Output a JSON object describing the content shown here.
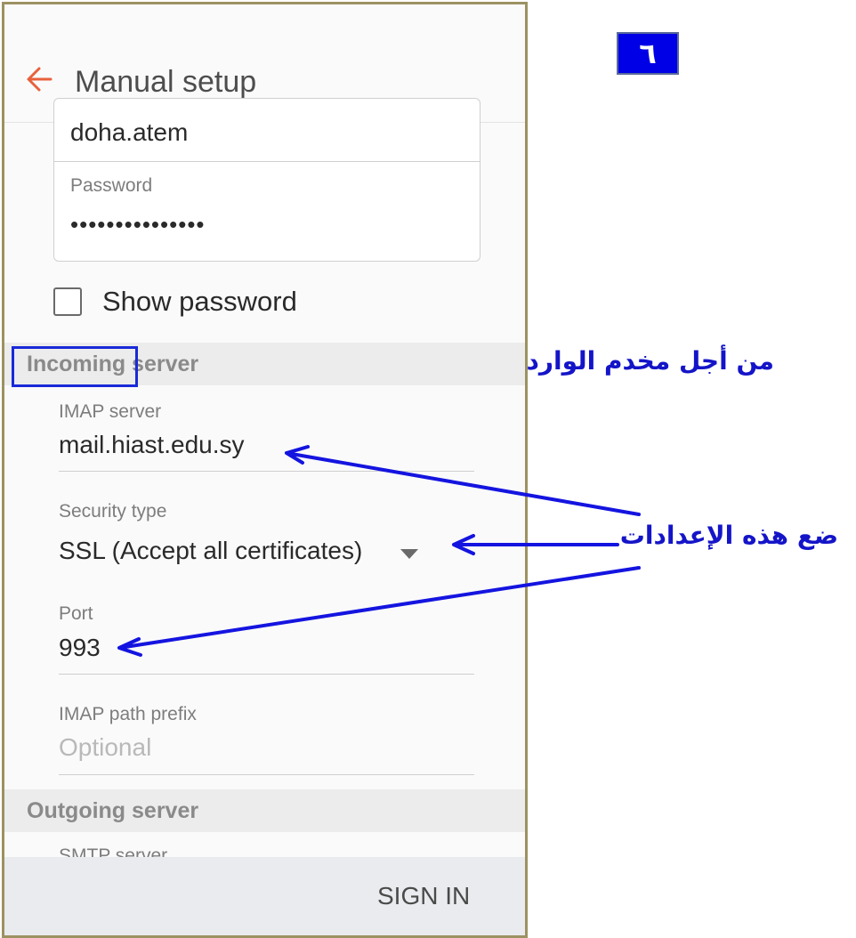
{
  "header": {
    "title": "Manual setup"
  },
  "account": {
    "username": "doha.atem",
    "password_label": "Password",
    "password_value": "•••••••••••••••",
    "show_password_label": "Show password"
  },
  "incoming": {
    "section_title": "Incoming server",
    "imap_label": "IMAP server",
    "imap_value": "mail.hiast.edu.sy",
    "security_label": "Security type",
    "security_value": "SSL (Accept all certificates)",
    "port_label": "Port",
    "port_value": "993",
    "prefix_label": "IMAP path prefix",
    "prefix_placeholder": "Optional"
  },
  "outgoing": {
    "section_title": "Outgoing server",
    "smtp_label": "SMTP server"
  },
  "footer": {
    "sign_in_label": "SIGN IN"
  },
  "annotations": {
    "step_number": "٦",
    "incoming_note": "من أجل مخدم الوارد",
    "settings_note": "ضع هذه الإعدادات"
  },
  "colors": {
    "accent_back": "#e8613c",
    "annotation": "#1414c8",
    "frame": "#9c9262"
  }
}
